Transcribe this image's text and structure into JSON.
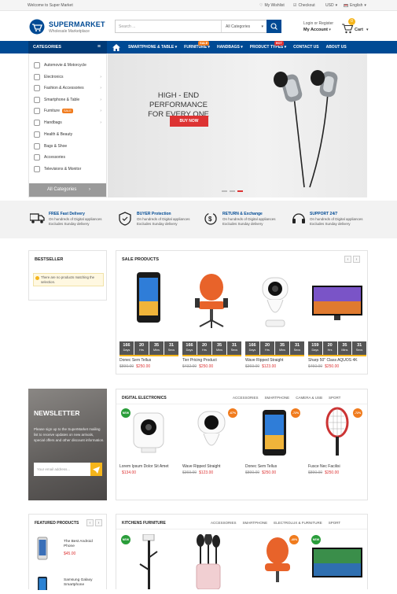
{
  "topbar": {
    "welcome": "Welcome to Super Market",
    "wishlist": "My Wishlist",
    "checkout": "Checkout",
    "currency": "USD",
    "language": "English"
  },
  "header": {
    "logo_title": "SUPERMARKET",
    "logo_sub": "Wholesale Marketplace",
    "search_placeholder": "Search ...",
    "search_category": "All Categories",
    "login": "Login or Register",
    "account": "My Account",
    "cart_label": "Cart",
    "cart_count": "0"
  },
  "nav": {
    "categories": "CATEGORIES",
    "items": [
      {
        "label": "SMARTPHONE & TABLE",
        "badge": ""
      },
      {
        "label": "FURNITURE",
        "badge": "SALE"
      },
      {
        "label": "HANDBAGS",
        "badge": ""
      },
      {
        "label": "PRODUCT TYPES",
        "badge": "HOT"
      },
      {
        "label": "CONTACT US",
        "badge": ""
      },
      {
        "label": "ABOUT US",
        "badge": ""
      }
    ]
  },
  "sidebar": {
    "items": [
      {
        "label": "Automovie & Motorcycle",
        "chev": false
      },
      {
        "label": "Electronics",
        "chev": true
      },
      {
        "label": "Fashion & Accessories",
        "chev": true
      },
      {
        "label": "Smartphone & Table",
        "chev": true
      },
      {
        "label": "Furniture",
        "chev": true
      },
      {
        "label": "Handbags",
        "chev": true
      },
      {
        "label": "Health & Beauty",
        "chev": false
      },
      {
        "label": "Bags & Shoe",
        "chev": false
      },
      {
        "label": "Accessories",
        "chev": false
      },
      {
        "label": "Televisions & Monitor",
        "chev": false
      }
    ],
    "all": "All Categories",
    "furniture_badge": "SALE"
  },
  "hero": {
    "line1": "HIGH - END PERFORMANCE",
    "line2": "FOR EVERY ONE",
    "button": "BUY NOW"
  },
  "features": [
    {
      "title": "FREE Fast Delivery",
      "line1": "On hundreds of Digital appliances",
      "line2": "Excludes Sunday delivery"
    },
    {
      "title": "BUYER Protection",
      "line1": "On hundreds of Digital appliances",
      "line2": "Excludes Sunday delivery"
    },
    {
      "title": "RETURN & Exchange",
      "line1": "On hundreds of Digital appliances",
      "line2": "Excludes Sunday delivery"
    },
    {
      "title": "SUPPORT 24/7",
      "line1": "On hundreds of Digital appliances",
      "line2": "Excludes Sunday delivery"
    }
  ],
  "bestseller": {
    "title": "BESTSELLER",
    "empty": "There are no products matching the selection."
  },
  "sale": {
    "title": "SALE PRODUCTS",
    "timer_units": [
      "Days",
      "Hrs",
      "Mins",
      "Secs"
    ],
    "products": [
      {
        "name": "Donec Sem Tellus",
        "old": "$890.00",
        "new": "$250.00",
        "timer": [
          "166",
          "20",
          "35",
          "31"
        ]
      },
      {
        "name": "Tier Pricing Product",
        "old": "$432.00",
        "new": "$250.00",
        "timer": [
          "166",
          "20",
          "35",
          "31"
        ]
      },
      {
        "name": "Wave Ripped Straight",
        "old": "$369.00",
        "new": "$123.00",
        "timer": [
          "166",
          "20",
          "35",
          "31"
        ]
      },
      {
        "name": "Sharp 50\" Class AQUOS 4K",
        "old": "$450.00",
        "new": "$250.00",
        "timer": [
          "159",
          "20",
          "35",
          "31"
        ]
      }
    ]
  },
  "newsletter": {
    "title": "NEWSLETTER",
    "desc": "Please sign up to the SuperMarket mailing list to receive updates on new arrivals, special offers and other discount information.",
    "placeholder": "Your email address..."
  },
  "digital": {
    "title": "DIGITAL ELECTRONICS",
    "tabs": [
      "ACCESSORIES",
      "SMARTPHONE",
      "CAMERA & USB",
      "SPORT"
    ],
    "badges": [
      "NEW",
      "-67%",
      "-72%",
      "-72%"
    ],
    "products": [
      {
        "name": "Lorem Ipsum Dolor Sit Amet",
        "old": "",
        "new": "$134.00"
      },
      {
        "name": "Wave Ripped Straight",
        "old": "$369.00",
        "new": "$123.00"
      },
      {
        "name": "Donec Sem Tellus",
        "old": "$890.00",
        "new": "$250.00"
      },
      {
        "name": "Fusce Nec Facilisi",
        "old": "$890.00",
        "new": "$250.00"
      }
    ]
  },
  "featured": {
    "title": "FEATURED PRODUCTS",
    "products": [
      {
        "name": "The Best Android Phone",
        "price": "$45.00"
      },
      {
        "name": "Samsung Galaxy Smartphone",
        "price": ""
      }
    ]
  },
  "kitchens": {
    "title": "KITCHENS FURNITURE",
    "tabs": [
      "ACCESSORIES",
      "SMARTPHONE",
      "ELECTROLUX & FURNITURE",
      "SPORT"
    ],
    "badges": [
      "NEW",
      "-40%",
      "NEW"
    ]
  },
  "colors": {
    "brand": "#004a94",
    "sale": "#dd3333",
    "accent": "#f5b51b"
  }
}
